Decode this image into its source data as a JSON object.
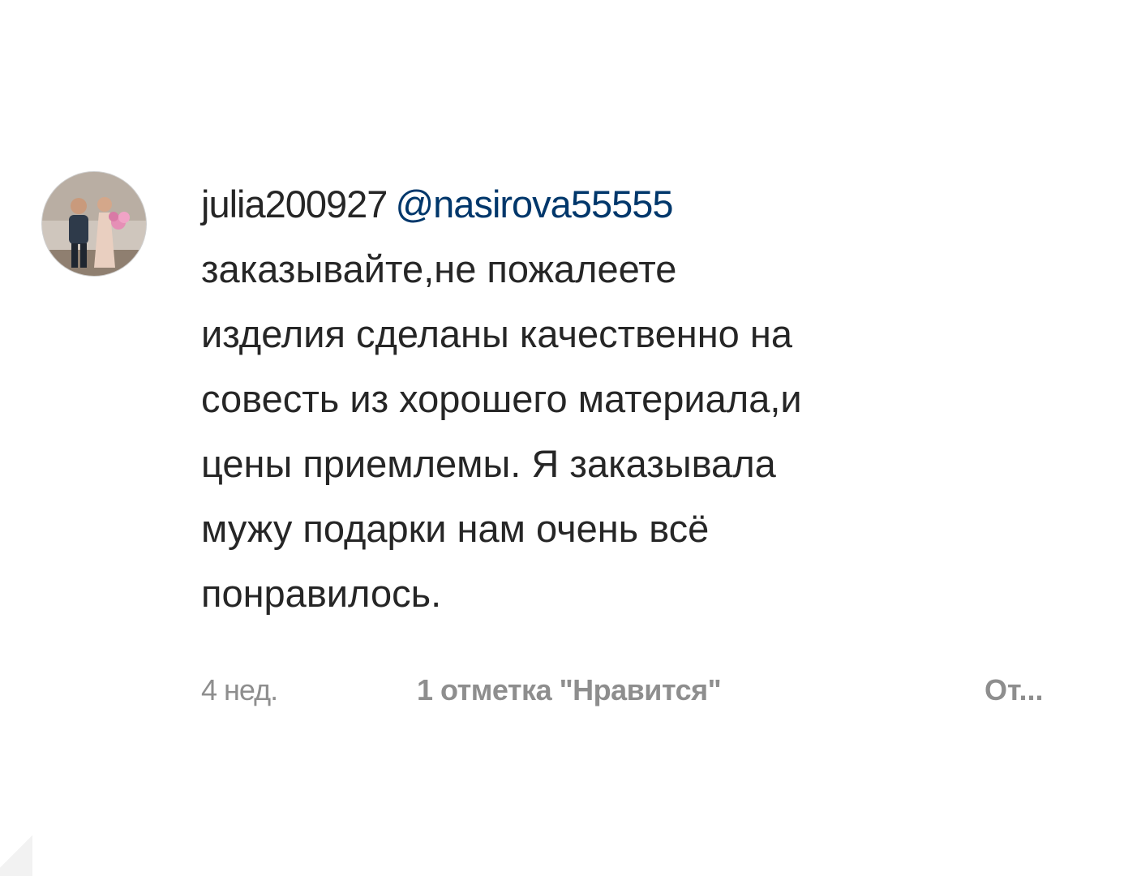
{
  "comment": {
    "username": "julia200927",
    "mention": "@nasirova55555",
    "text": "заказывайте,не пожалеете\nизделия сделаны качественно на\nсовесть из хорошего материала,и\nцены приемлемы. Я заказывала\nмужу подарки нам очень всё\nпонравилось.",
    "time_ago": "4 нед.",
    "likes_label": "1 отметка \"Нравится\"",
    "reply_label": "От..."
  },
  "colors": {
    "text": "#262626",
    "mention": "#00376b",
    "meta": "#8e8e8e",
    "background": "#ffffff"
  }
}
